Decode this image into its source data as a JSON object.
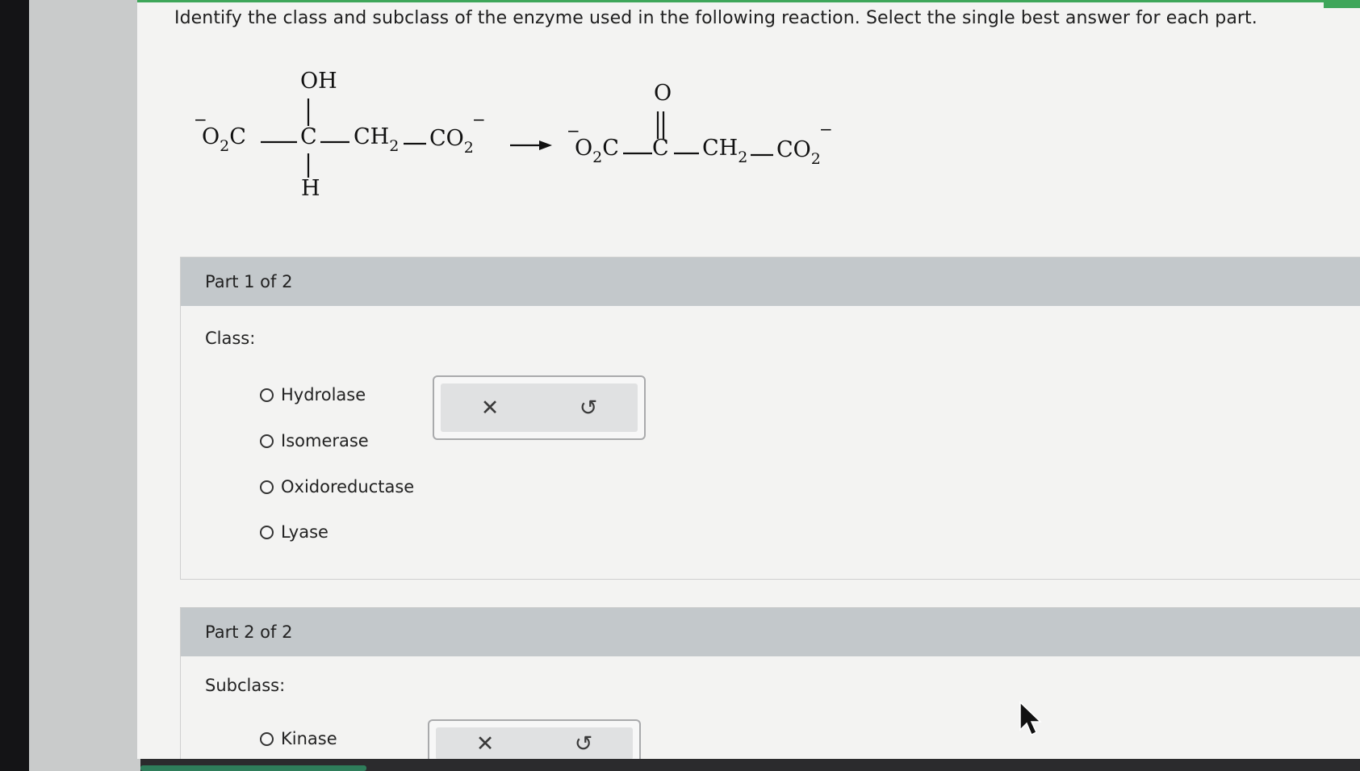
{
  "question": "Identify the class and subclass of the enzyme used in the following reaction. Select the single best answer for each part.",
  "reaction": {
    "reactant": {
      "left_group": "O₂C",
      "left_charge": "−",
      "top": "OH",
      "center": "C",
      "bottom": "H",
      "chain": "CH₂",
      "right_group": "CO₂",
      "right_charge": "−"
    },
    "arrow": "⟶",
    "product": {
      "left_group": "O₂C",
      "left_charge": "−",
      "top": "O",
      "center": "C",
      "chain": "CH₂",
      "right_group": "CO₂",
      "right_charge": "−"
    }
  },
  "part1": {
    "header": "Part 1 of 2",
    "label": "Class:",
    "options": [
      "Hydrolase",
      "Isomerase",
      "Oxidoreductase",
      "Lyase"
    ],
    "clear_icon": "✕",
    "undo_icon": "↺"
  },
  "part2": {
    "header": "Part 2 of 2",
    "label": "Subclass:",
    "options": [
      "Kinase"
    ],
    "clear_icon": "✕",
    "undo_icon": "↺"
  },
  "colors": {
    "accent_green": "#3ea65a",
    "header_gray": "#c3c8cb"
  }
}
